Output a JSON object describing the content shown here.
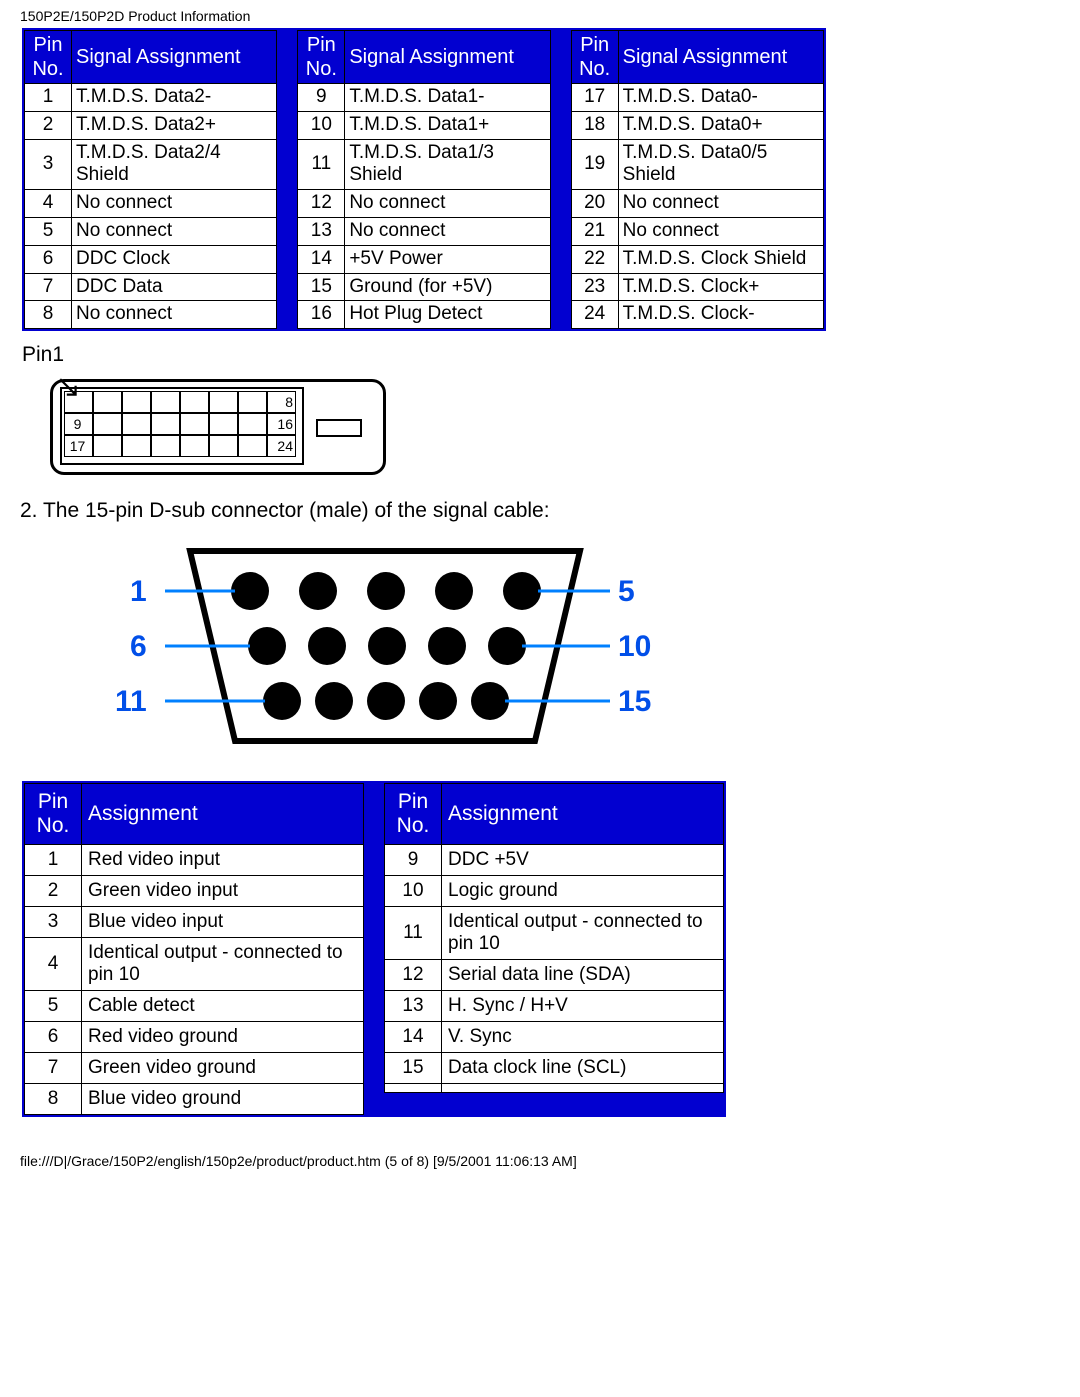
{
  "header": "150P2E/150P2D Product Information",
  "table1_headers": {
    "pin": "Pin No.",
    "assign": "Signal Assignment"
  },
  "dvi_pins": {
    "col1": [
      {
        "n": "1",
        "a": "T.M.D.S. Data2-"
      },
      {
        "n": "2",
        "a": "T.M.D.S. Data2+"
      },
      {
        "n": "3",
        "a": "T.M.D.S. Data2/4 Shield"
      },
      {
        "n": "4",
        "a": "No connect"
      },
      {
        "n": "5",
        "a": "No connect"
      },
      {
        "n": "6",
        "a": "DDC Clock"
      },
      {
        "n": "7",
        "a": "DDC Data"
      },
      {
        "n": "8",
        "a": "No connect"
      }
    ],
    "col2": [
      {
        "n": "9",
        "a": "T.M.D.S. Data1-"
      },
      {
        "n": "10",
        "a": "T.M.D.S. Data1+"
      },
      {
        "n": "11",
        "a": "T.M.D.S. Data1/3 Shield"
      },
      {
        "n": "12",
        "a": "No connect"
      },
      {
        "n": "13",
        "a": "No connect"
      },
      {
        "n": "14",
        "a": "+5V Power"
      },
      {
        "n": "15",
        "a": "Ground (for +5V)"
      },
      {
        "n": "16",
        "a": "Hot Plug Detect"
      }
    ],
    "col3": [
      {
        "n": "17",
        "a": "T.M.D.S. Data0-"
      },
      {
        "n": "18",
        "a": "T.M.D.S. Data0+"
      },
      {
        "n": "19",
        "a": "T.M.D.S. Data0/5 Shield"
      },
      {
        "n": "20",
        "a": "No connect"
      },
      {
        "n": "21",
        "a": "No connect"
      },
      {
        "n": "22",
        "a": "T.M.D.S. Clock Shield"
      },
      {
        "n": "23",
        "a": "T.M.D.S. Clock+"
      },
      {
        "n": "24",
        "a": "T.M.D.S. Clock-"
      }
    ]
  },
  "pin1_label": "Pin1",
  "dvi_diagram_labels": {
    "r1": "8",
    "r2l": "9",
    "r2r": "16",
    "r3l": "17",
    "r3r": "24"
  },
  "dsub_desc": "2. The 15-pin D-sub connector (male) of the signal cable:",
  "dsub_labels": {
    "l1": "1",
    "l2": "6",
    "l3": "11",
    "r1": "5",
    "r2": "10",
    "r3": "15"
  },
  "table2_headers": {
    "pin": "Pin No.",
    "assign": "Assignment"
  },
  "dsub_pins": {
    "col1": [
      {
        "n": "1",
        "a": "Red video input"
      },
      {
        "n": "2",
        "a": "Green video input"
      },
      {
        "n": "3",
        "a": "Blue video input"
      },
      {
        "n": "4",
        "a": "Identical output - connected to pin 10"
      },
      {
        "n": "5",
        "a": "Cable detect"
      },
      {
        "n": "6",
        "a": "Red video ground"
      },
      {
        "n": "7",
        "a": "Green video ground"
      },
      {
        "n": "8",
        "a": "Blue video ground"
      }
    ],
    "col2": [
      {
        "n": "9",
        "a": "DDC +5V"
      },
      {
        "n": "10",
        "a": "Logic ground"
      },
      {
        "n": "11",
        "a": "Identical output - connected to pin 10"
      },
      {
        "n": "12",
        "a": "Serial data line (SDA)"
      },
      {
        "n": "13",
        "a": "H. Sync / H+V"
      },
      {
        "n": "14",
        "a": "V. Sync"
      },
      {
        "n": "15",
        "a": "Data clock line (SCL)"
      },
      {
        "n": "",
        "a": ""
      }
    ]
  },
  "footer": "file:///D|/Grace/150P2/english/150p2e/product/product.htm (5 of 8) [9/5/2001 11:06:13 AM]"
}
